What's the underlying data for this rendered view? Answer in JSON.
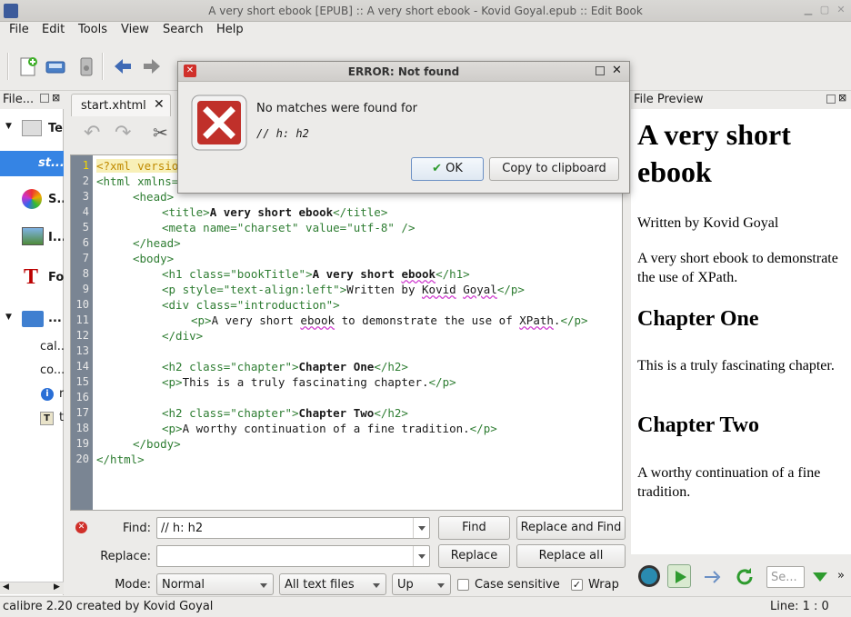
{
  "window": {
    "title": "A very short ebook [EPUB] :: A very short ebook - Kovid Goyal.epub :: Edit Book"
  },
  "menu": [
    "File",
    "Edit",
    "Tools",
    "View",
    "Search",
    "Help"
  ],
  "left_panel": {
    "header": "File...",
    "items": [
      {
        "label": "Te",
        "icon": "text-icon"
      },
      {
        "label": "st...",
        "icon": "",
        "selected": true
      },
      {
        "label": "S...",
        "icon": "styles-icon"
      },
      {
        "label": "I...",
        "icon": "images-icon"
      },
      {
        "label": "Fo",
        "icon": "fonts-icon"
      },
      {
        "label": "...",
        "icon": "folder-icon"
      },
      {
        "label": "cal...",
        "icon": ""
      },
      {
        "label": "co...",
        "icon": ""
      },
      {
        "label": "r",
        "icon": "info-icon"
      },
      {
        "label": "t",
        "icon": "text-file-icon"
      }
    ]
  },
  "editor": {
    "tab_label": "start.xhtml",
    "lines": [
      "1",
      "2",
      "3",
      "4",
      "5",
      "6",
      "7",
      "8",
      "9",
      "10",
      "11",
      "12",
      "13",
      "14",
      "15",
      "16",
      "17",
      "18",
      "19",
      "20"
    ],
    "code": {
      "l1": "<?xml versio",
      "l2a": "<html",
      "l2b": " xmlns=",
      "l3": "<head>",
      "l4a": "<title>",
      "l4b": "A very short ebook",
      "l4c": "</title>",
      "l5a": "<meta",
      "l5b": " name=",
      "l5c": "\"charset\"",
      "l5d": " value=",
      "l5e": "\"utf-8\"",
      "l5f": " />",
      "l6": "</head>",
      "l7": "<body>",
      "l8a": "<h1",
      "l8b": " class=",
      "l8c": "\"bookTitle\"",
      "l8d": ">",
      "l8e": "A very short ",
      "l8f": "ebook",
      "l8g": "</h1>",
      "l9a": "<p",
      "l9b": " style=",
      "l9c": "\"text-align:left\"",
      "l9d": ">",
      "l9e": "Written by ",
      "l9f": "Kovid",
      "l9g": " ",
      "l9h": "Goyal",
      "l9i": "</p>",
      "l10a": "<div",
      "l10b": " class=",
      "l10c": "\"introduction\"",
      "l10d": ">",
      "l11a": "<p>",
      "l11b": "A very short ",
      "l11c": "ebook",
      "l11d": " to demonstrate the use of ",
      "l11e": "XPath",
      "l11f": ".",
      "l11g": "</p>",
      "l12": "</div>",
      "l14a": "<h2",
      "l14b": " class=",
      "l14c": "\"chapter\"",
      "l14d": ">",
      "l14e": "Chapter One",
      "l14f": "</h2>",
      "l15a": "<p>",
      "l15b": "This is a truly fascinating chapter.",
      "l15c": "</p>",
      "l17a": "<h2",
      "l17b": " class=",
      "l17c": "\"chapter\"",
      "l17d": ">",
      "l17e": "Chapter Two",
      "l17f": "</h2>",
      "l18a": "<p>",
      "l18b": "A worthy continuation of a fine tradition.",
      "l18c": "</p>",
      "l19": "</body>",
      "l20": "</html>"
    }
  },
  "find_bar": {
    "find_label": "Find:",
    "find_value": "// h: h2",
    "replace_label": "Replace:",
    "replace_value": "",
    "mode_label": "Mode:",
    "mode_value": "Normal",
    "scope_value": "All text files",
    "direction_value": "Up",
    "case_sensitive_label": "Case sensitive",
    "case_sensitive": false,
    "wrap_label": "Wrap",
    "wrap": true,
    "buttons": {
      "find": "Find",
      "replace_and_find": "Replace and Find",
      "replace": "Replace",
      "replace_all": "Replace all"
    }
  },
  "preview": {
    "header": "File Preview",
    "title": "A very short ebook",
    "author_line": "Written by Kovid Goyal",
    "intro": "A very short ebook to demonstrate the use of XPath.",
    "chapter1_title": "Chapter One",
    "chapter1_text": "This is a truly fascinating chapter.",
    "chapter2_title": "Chapter Two",
    "chapter2_text": "A worthy continuation of a fine tradition.",
    "search_placeholder": "Se...",
    "more": "»"
  },
  "status": {
    "left": "calibre 2.20 created by Kovid Goyal",
    "right": "Line: 1 : 0"
  },
  "dialog": {
    "title": "ERROR: Not found",
    "message": "No matches were found for",
    "query": "// h: h2",
    "ok_label": "OK",
    "copy_label": "Copy to clipboard"
  },
  "colors": {
    "selection": "#3584e4",
    "error_red": "#c0302a",
    "gutter": "#7a8593",
    "code_green": "#2e7d32"
  }
}
